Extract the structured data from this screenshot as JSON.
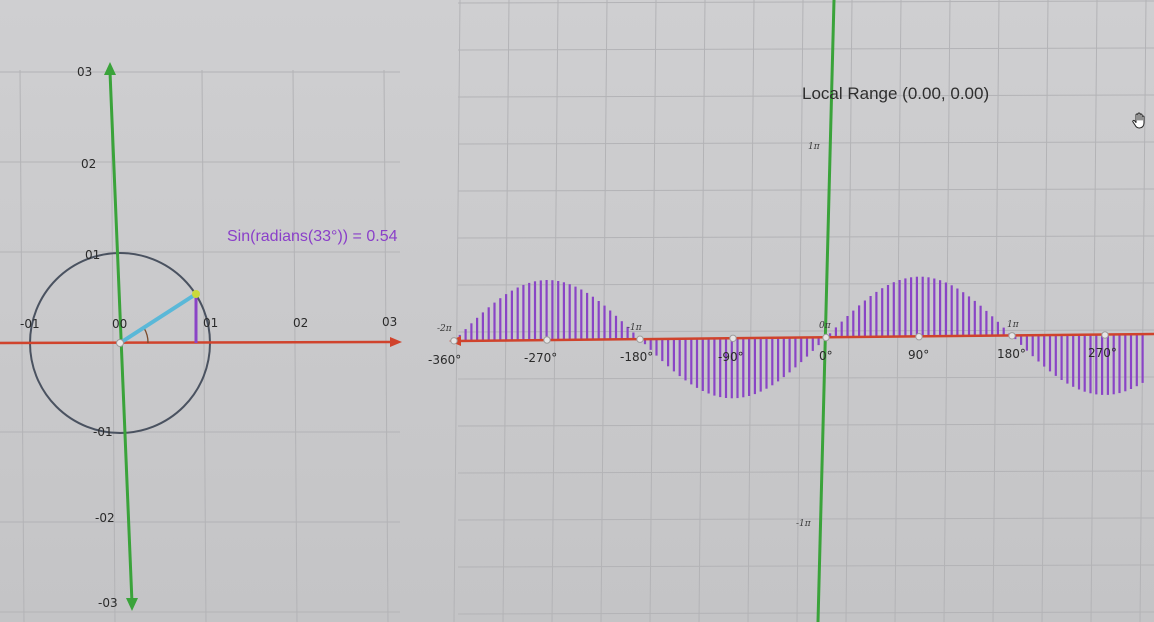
{
  "title": "Local Range (0.00, 0.00)",
  "formula": "Sin(radians(33°)) = 0.54",
  "angle_deg": 33,
  "sin_value": 0.54,
  "colors": {
    "background": "#c9c9cb",
    "grid": "#b3b3b6",
    "x_axis": "#d0432c",
    "y_axis": "#3aa33a",
    "unit_circle": "#4a5260",
    "radius_line": "#5ab8d8",
    "sine_bars": "#8a44c6",
    "formula_text": "#8a3fc9",
    "endpoint": "#c9d93a"
  },
  "unit_circle_panel": {
    "x_ticks": [
      "-01",
      "00",
      "01",
      "02",
      "03"
    ],
    "y_ticks": [
      "03",
      "02",
      "01",
      "-01",
      "-02",
      "-03"
    ]
  },
  "wave_panel": {
    "degree_ticks": [
      "-360°",
      "-270°",
      "-180°",
      "-90°",
      "0°",
      "90°",
      "180°",
      "270°"
    ],
    "pi_ticks": [
      "-2π",
      "-1π",
      "0π",
      "1π"
    ],
    "y_pi_ticks": [
      "1π",
      "-1π"
    ]
  },
  "icons": [
    "hand-cursor-icon"
  ]
}
